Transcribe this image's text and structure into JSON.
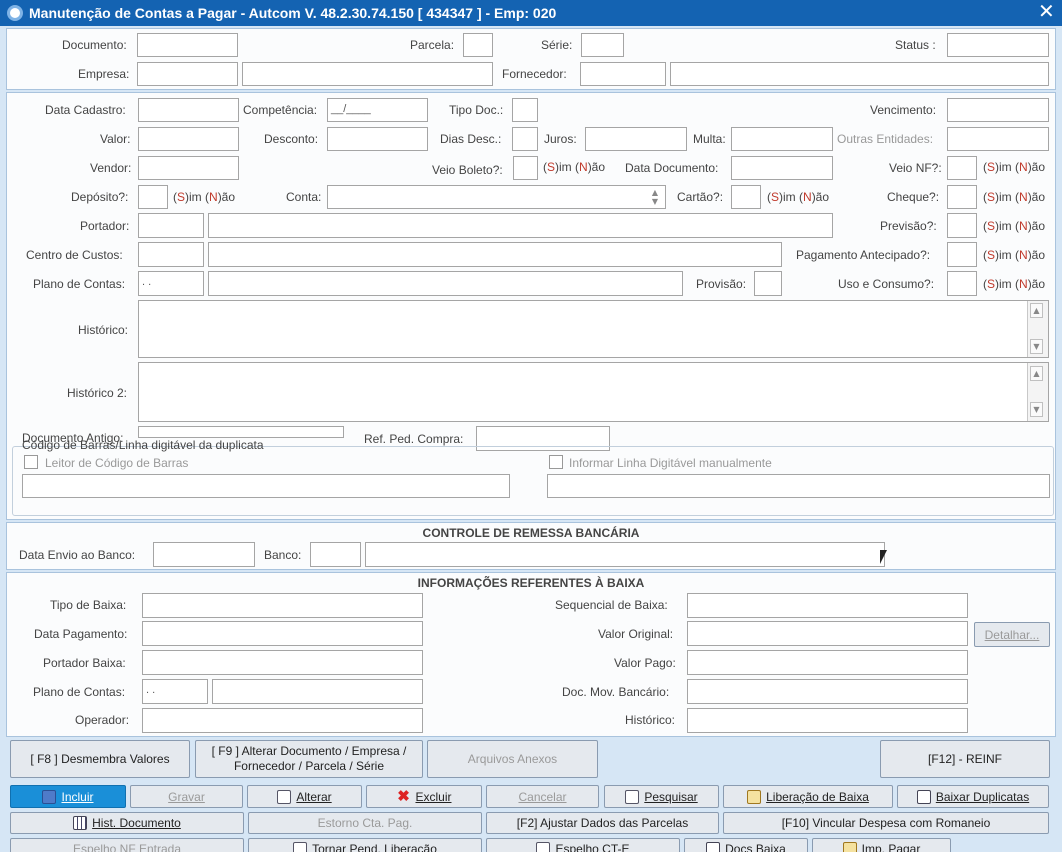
{
  "window": {
    "title": "Manutenção de Contas a Pagar   -   Autcom V. 48.2.30.74.150 [ 434347 ] - Emp: 020",
    "close": "✕"
  },
  "header": {
    "documento": "Documento:",
    "parcela": "Parcela:",
    "serie": "Série:",
    "status": "Status :",
    "empresa": "Empresa:",
    "fornecedor": "Fornecedor:"
  },
  "form": {
    "data_cadastro": "Data Cadastro:",
    "competencia": "Competência:",
    "competencia_value": "__/____",
    "tipo_doc": "Tipo Doc.:",
    "vencimento": "Vencimento:",
    "valor": "Valor:",
    "desconto": "Desconto:",
    "dias_desc": "Dias Desc.:",
    "juros": "Juros:",
    "multa": "Multa:",
    "outras_entidades": "Outras Entidades:",
    "vendor": "Vendor:",
    "veio_boleto": "Veio Boleto?:",
    "data_documento": "Data Documento:",
    "veio_nf": "Veio NF?:",
    "deposito": "Depósito?:",
    "conta": "Conta:",
    "cartao": "Cartão?:",
    "cheque": "Cheque?:",
    "portador": "Portador:",
    "previsao": "Previsão?:",
    "centro_custos": "Centro de Custos:",
    "pagamento_antecipado": "Pagamento Antecipado?:",
    "plano_contas": "Plano de Contas:",
    "plano_contas_value": " .  .",
    "provisao": "Provisão:",
    "uso_consumo": "Uso e Consumo?:",
    "historico": "Histórico:",
    "historico2": "Histórico 2:",
    "documento_antigo": "Documento Antigo:",
    "ref_ped_compra": "Ref. Ped. Compra:",
    "sn": {
      "s_open": "(",
      "s": "S",
      "s_close": ")im ",
      "n_open": "(",
      "n": "N",
      "n_close": ")ão"
    }
  },
  "barcode": {
    "group_title": "Código de Barras/Linha digitável da duplicata",
    "leitor": "Leitor de Código de Barras",
    "manual": "Informar Linha Digitável manualmente"
  },
  "remessa": {
    "title": "CONTROLE DE REMESSA BANCÁRIA",
    "data_envio": "Data Envio ao Banco:",
    "banco": "Banco:"
  },
  "baixa": {
    "title": "INFORMAÇÕES REFERENTES À BAIXA",
    "tipo_baixa": "Tipo de Baixa:",
    "data_pagamento": "Data Pagamento:",
    "portador_baixa": "Portador Baixa:",
    "plano_contas": "Plano de Contas:",
    "plano_contas_value": " .  .",
    "operador": "Operador:",
    "sequencial": "Sequencial de Baixa:",
    "valor_original": "Valor Original:",
    "valor_pago": "Valor Pago:",
    "doc_mov": "Doc. Mov. Bancário:",
    "historico": "Histórico:",
    "detalhar": "Detalhar..."
  },
  "actions": {
    "f8": "[ F8 ] Desmembra Valores",
    "f9_line1": "[ F9 ] Alterar Documento / Empresa /",
    "f9_line2": "Fornecedor / Parcela / Série",
    "arquivos": "Arquivos Anexos",
    "f12": "[F12] - REINF"
  },
  "toolbar": {
    "incluir": "Incluir",
    "gravar": "Gravar",
    "alterar": "Alterar",
    "excluir": "Excluir",
    "cancelar": "Cancelar",
    "pesquisar": "Pesquisar",
    "liberacao_baixa": "Liberação de Baixa",
    "baixar_duplicatas": "Baixar Duplicatas",
    "hist_documento": "Hist. Documento",
    "estorno": "Estorno Cta. Pag.",
    "f2": "[F2] Ajustar Dados das Parcelas",
    "f10": "[F10] Vincular Despesa com Romaneio",
    "espelho_nf": "Espelho NF Entrada",
    "tornar_pend": "Tornar Pend. Liberação",
    "espelho_cte": "Espelho CT-E",
    "docs_baixa": "Docs Baixa",
    "imp_pagar": "Imp. Pagar"
  },
  "colors": {
    "titlebar": "#1463b2",
    "accent_red": "#c0392b",
    "selected_button": "#1a8fd8"
  }
}
